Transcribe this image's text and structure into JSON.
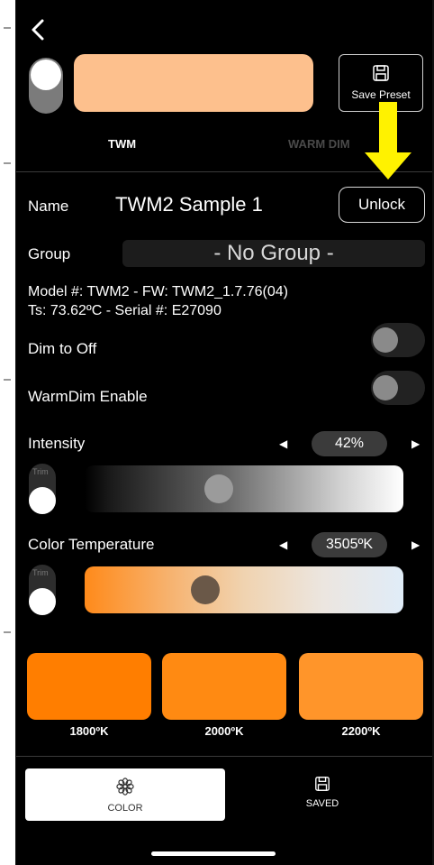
{
  "header": {
    "main_color": "#FDC08D",
    "save_preset_label": "Save Preset"
  },
  "tabs": [
    {
      "label": "TWM"
    },
    {
      "label": "WARM DIM"
    }
  ],
  "form": {
    "name_label": "Name",
    "name_value": "TWM2 Sample 1",
    "unlock_label": "Unlock",
    "group_label": "Group",
    "group_value": "- No Group -",
    "model_line": "Model #: TWM2 - FW: TWM2_1.7.76(04)",
    "ts_line": "Ts: 73.62ºC - Serial #: E27090",
    "dim_to_off_label": "Dim to Off",
    "warmdim_label": "WarmDim Enable"
  },
  "intensity": {
    "label": "Intensity",
    "value_text": "42%",
    "value": 0.42,
    "trim_label": "Trim"
  },
  "color_temperature": {
    "label": "Color Temperature",
    "value_text": "3505ºK",
    "trim_label": "Trim"
  },
  "presets": [
    {
      "label": "1800ºK",
      "color": "#FF7E00"
    },
    {
      "label": "2000ºK",
      "color": "#FF8A12"
    },
    {
      "label": "2200ºK",
      "color": "#FF952A"
    }
  ],
  "bottom_nav": {
    "color_label": "COLOR",
    "saved_label": "SAVED"
  },
  "colors": {
    "annotation_arrow": "#FFF200",
    "background": "#000000"
  }
}
